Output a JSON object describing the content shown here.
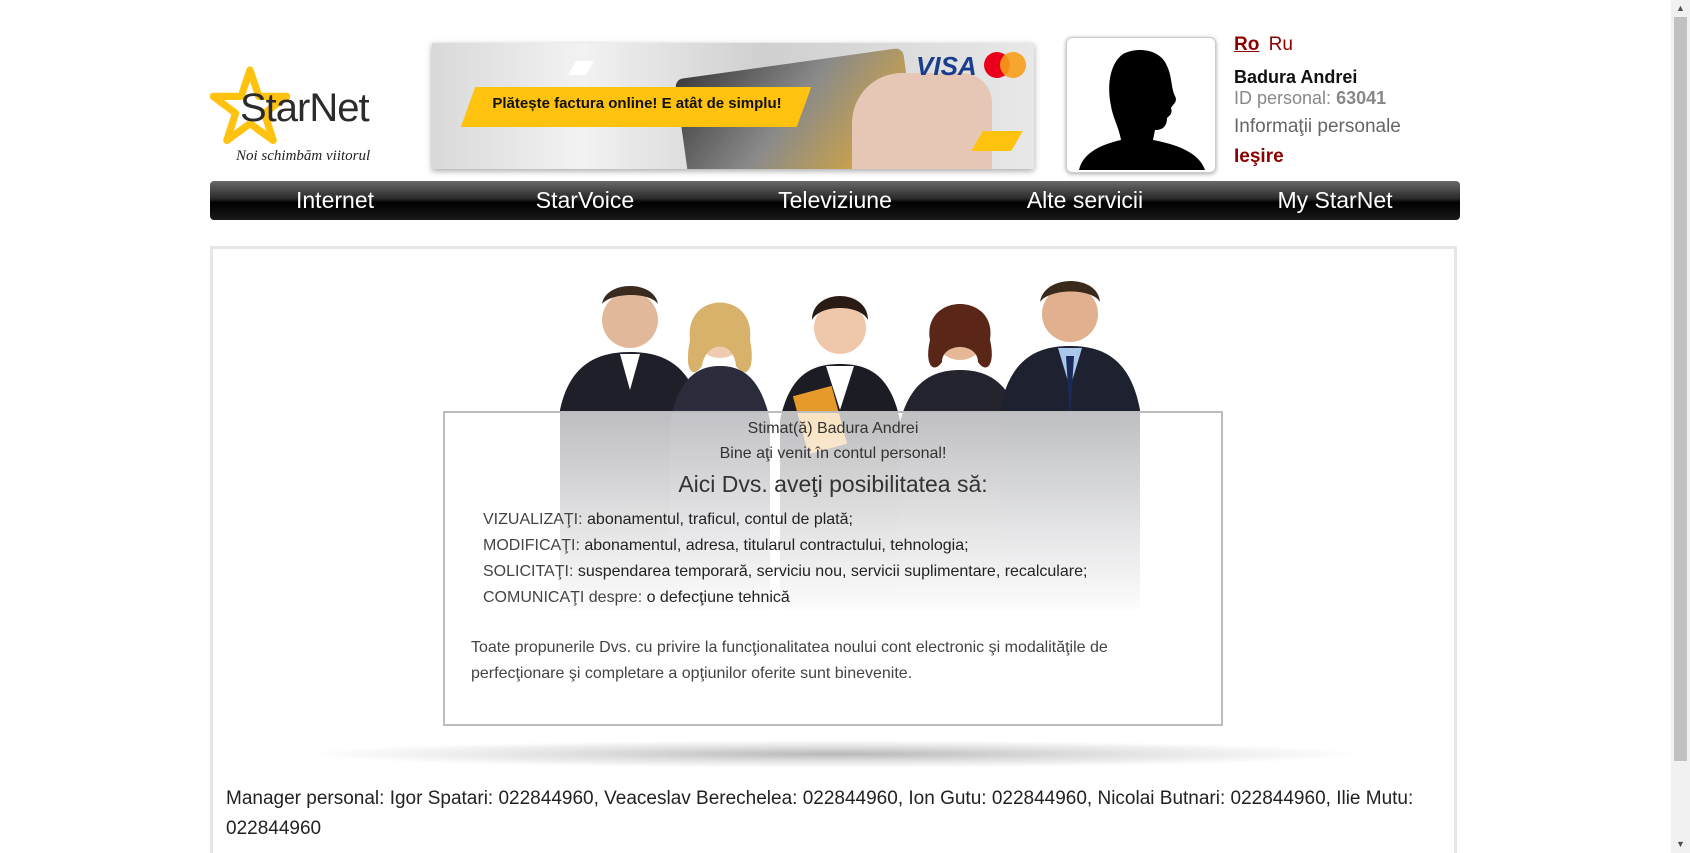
{
  "logo": {
    "name": "StarNet",
    "slogan": "Noi schimbăm viitorul"
  },
  "banner": {
    "text": "Plătește factura online! E atât de simplu!",
    "visa": "VISA",
    "mastercard": "MasterCard"
  },
  "lang": {
    "ro": "Ro",
    "ru": "Ru"
  },
  "user": {
    "name": "Badura Andrei",
    "id_label": "ID personal: ",
    "id_value": "63041",
    "info_link": "Informaţii personale",
    "logout": "Ieşire"
  },
  "nav": {
    "items": [
      "Internet",
      "StarVoice",
      "Televiziune",
      "Alte servicii",
      "My StarNet"
    ]
  },
  "welcome": {
    "greeting": "Stimat(ă) Badura Andrei",
    "welcome_line": "Bine aţi venit în contul personal!",
    "heading": "Aici Dvs. aveţi posibilitatea să:",
    "items": [
      {
        "key": "VIZUALIZAŢI:",
        "text": " abonamentul, traficul, contul de plată;"
      },
      {
        "key": "MODIFICAŢI:",
        "text": " abonamentul, adresa, titularul contractului, tehnologia;"
      },
      {
        "key": "SOLICITAŢI:",
        "text": " suspendarea temporară, serviciu nou, servicii suplimentare, recalculare;"
      },
      {
        "key": "COMUNICAŢI despre:",
        "text": " o defecţiune tehnică"
      }
    ],
    "note": "Toate propunerile Dvs. cu privire la funcţionalitatea noului cont electronic şi modalităţile de perfecţionare şi completare a opţiunilor oferite sunt binevenite."
  },
  "managers": "Manager personal: Igor Spatari: 022844960, Veaceslav Berechelea: 022844960, Ion Gutu: 022844960, Nicolai Butnari: 022844960, Ilie Mutu: 022844960",
  "colors": {
    "accent_red": "#8b0000",
    "banner_yellow": "#ffc20e",
    "nav_dark": "#000000"
  },
  "icons": {
    "logo": "star-logo-icon",
    "avatar": "silhouette-avatar-icon"
  }
}
